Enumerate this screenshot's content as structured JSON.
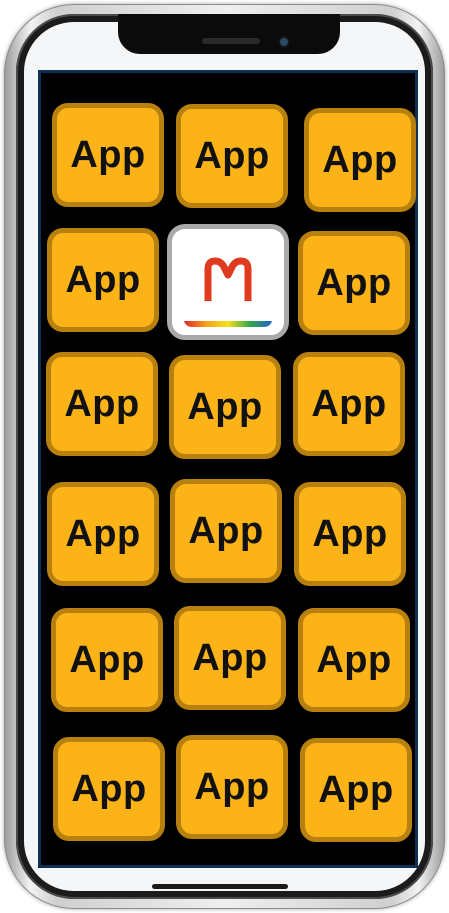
{
  "home_screen": {
    "app_labels": [
      "App",
      "App",
      "App",
      "App",
      "App",
      "App",
      "App",
      "App",
      "App",
      "App",
      "App",
      "App",
      "App",
      "App",
      "App",
      "App",
      "App"
    ],
    "featured_app": {
      "icon": "m-logo-icon",
      "logo_letter": "M"
    }
  },
  "colors": {
    "tile_fill": "#fbb317",
    "tile_border": "#b8800f",
    "screen_background": "#000000",
    "logo_red": "#e03a1e"
  }
}
